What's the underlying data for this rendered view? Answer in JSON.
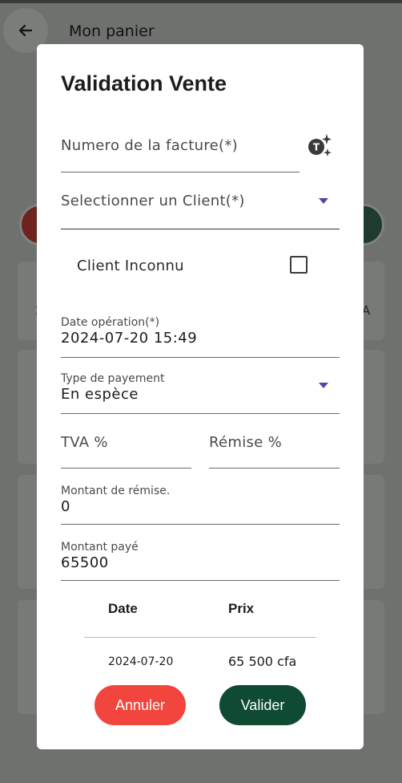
{
  "app": {
    "title": "Mon panier"
  },
  "background": {
    "left_text": "2",
    "right_text": "A"
  },
  "dialog": {
    "title": "Validation Vente",
    "invoice": {
      "placeholder": "Numero de la facture(*)"
    },
    "client": {
      "placeholder": "Selectionner un Client(*)"
    },
    "unknown_client": {
      "label": "Client Inconnu",
      "checked": false
    },
    "date": {
      "label": "Date opération(*)",
      "value": "2024-07-20 15:49"
    },
    "payment_type": {
      "label": "Type de payement",
      "value": "En espèce"
    },
    "tva": {
      "placeholder": "TVA %"
    },
    "remise": {
      "placeholder": "Rémise %"
    },
    "discount_amount": {
      "label": "Montant de rémise.",
      "value": "0"
    },
    "paid_amount": {
      "label": "Montant payé",
      "value": "65500"
    },
    "table": {
      "headers": [
        "Date",
        "Prix"
      ],
      "rows": [
        {
          "date": "2024-07-20",
          "price": "65 500 cfa"
        }
      ]
    },
    "buttons": {
      "cancel": "Annuler",
      "validate": "Valider"
    }
  },
  "colors": {
    "cancel": "#f1453d",
    "validate": "#0f4a33",
    "dropdown_accent": "#5b3fa8",
    "scrim": "#6f716f"
  },
  "icons": {
    "back": "arrow-left-icon",
    "invoice_generate": "sparkle-t-icon",
    "dropdown": "triangle-down-icon"
  }
}
